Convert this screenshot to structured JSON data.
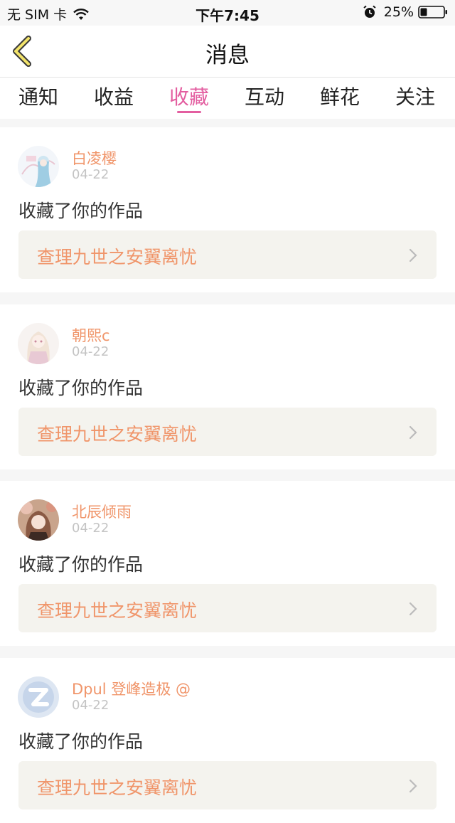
{
  "status_bar": {
    "carrier": "无 SIM 卡",
    "time": "下午7:45",
    "battery": "25%"
  },
  "nav": {
    "title": "消息"
  },
  "tabs": [
    {
      "label": "通知"
    },
    {
      "label": "收益"
    },
    {
      "label": "收藏",
      "active": true
    },
    {
      "label": "互动"
    },
    {
      "label": "鲜花"
    },
    {
      "label": "关注"
    }
  ],
  "colors": {
    "accent": "#e35ea0",
    "name": "#f0956a",
    "work_box": "#f4f3ee"
  },
  "items": [
    {
      "user": "白凌樱",
      "date": "04-22",
      "action": "收藏了你的作品",
      "work": "查理九世之安翼离忧"
    },
    {
      "user": "朝熙c",
      "date": "04-22",
      "action": "收藏了你的作品",
      "work": "查理九世之安翼离忧"
    },
    {
      "user": "北辰倾雨",
      "date": "04-22",
      "action": "收藏了你的作品",
      "work": "查理九世之安翼离忧"
    },
    {
      "user": "Dpul 登峰造极 @",
      "date": "04-22",
      "action": "收藏了你的作品",
      "work": "查理九世之安翼离忧"
    }
  ]
}
